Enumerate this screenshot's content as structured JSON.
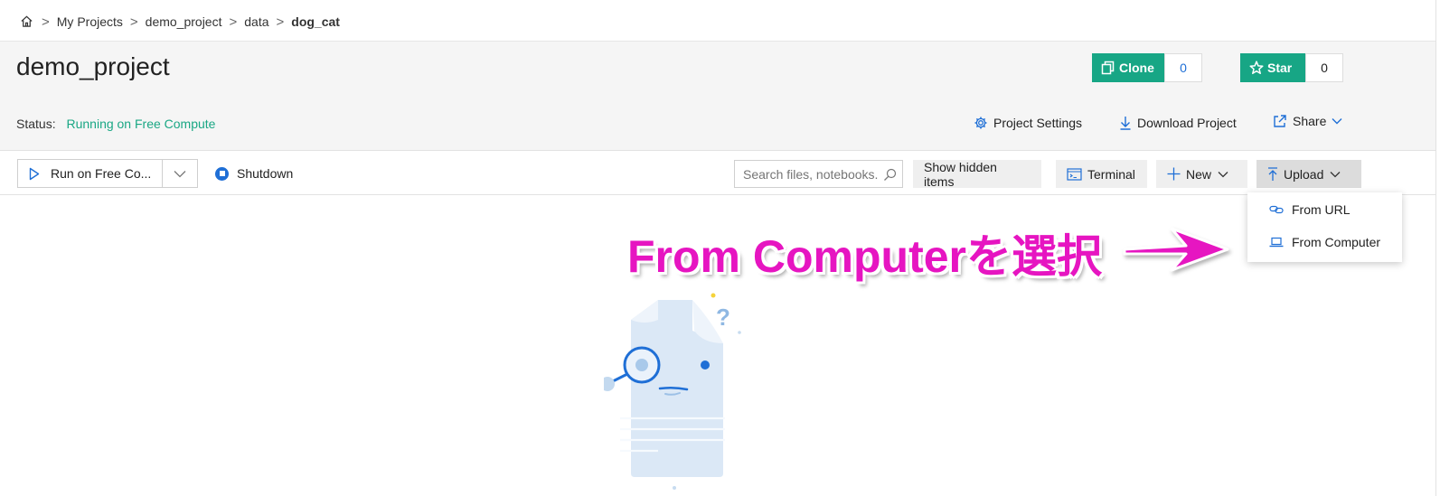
{
  "breadcrumb": {
    "home_icon": "home-icon",
    "items": [
      "My Projects",
      "demo_project",
      "data"
    ],
    "separator": ">",
    "current": "dog_cat"
  },
  "project": {
    "title": "demo_project",
    "status_label": "Status:",
    "status_value": "Running on Free Compute"
  },
  "header_actions": {
    "clone_label": "Clone",
    "clone_count": "0",
    "star_label": "Star",
    "star_count": "0",
    "settings_label": "Project Settings",
    "download_label": "Download Project",
    "share_label": "Share"
  },
  "toolbar": {
    "run_label": "Run on Free Co...",
    "shutdown_label": "Shutdown",
    "search_placeholder": "Search files, notebooks...",
    "show_hidden_label": "Show hidden items",
    "terminal_label": "Terminal",
    "new_label": "New",
    "upload_label": "Upload"
  },
  "upload_menu": {
    "items": [
      {
        "label": "From URL",
        "icon": "link-icon"
      },
      {
        "label": "From Computer",
        "icon": "laptop-icon"
      }
    ]
  },
  "annotation": {
    "text": "From Computerを選択"
  },
  "colors": {
    "accent_green": "#17a685",
    "status_green": "#1aa784",
    "link_blue": "#1f6fd6",
    "annotation_magenta": "#e615c1"
  }
}
